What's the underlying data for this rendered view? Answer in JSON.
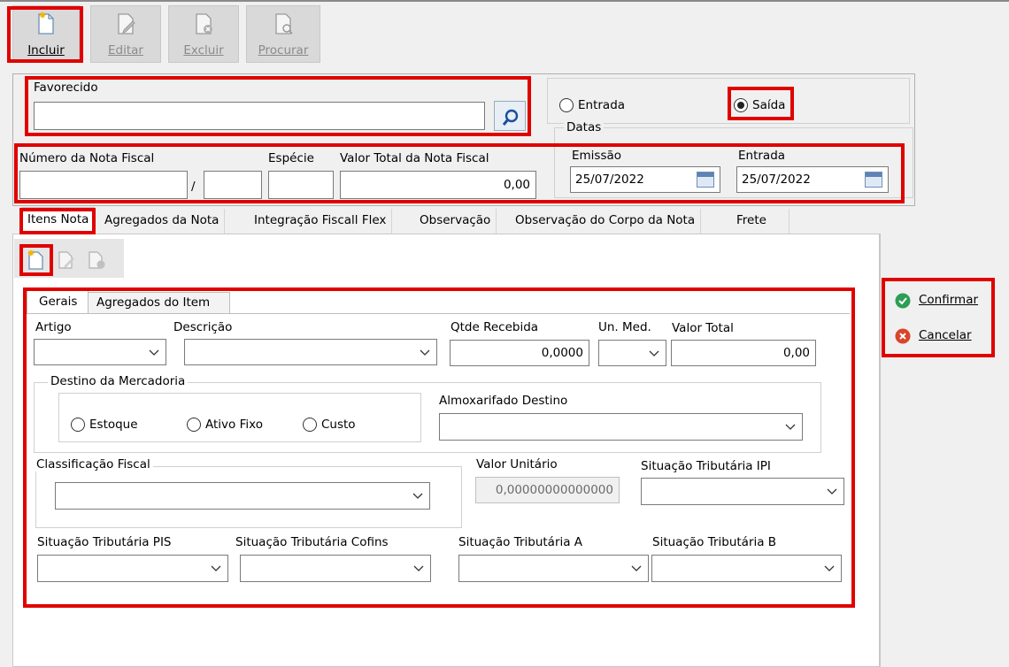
{
  "toolbar": {
    "incluir": "Incluir",
    "editar": "Editar",
    "excluir": "Excluir",
    "procurar": "Procurar"
  },
  "favorecido": {
    "label": "Favorecido",
    "value": ""
  },
  "tipo": {
    "entrada": "Entrada",
    "saida": "Saída",
    "selected": "Saída"
  },
  "datas": {
    "title": "Datas",
    "emissao_label": "Emissão",
    "emissao_value": "25/07/2022",
    "entrada_label": "Entrada",
    "entrada_value": "25/07/2022"
  },
  "nota": {
    "numero_label": "Número da Nota Fiscal",
    "separator": "/",
    "especie_label": "Espécie",
    "valor_total_label": "Valor Total da Nota Fiscal",
    "valor_total_value": "0,00"
  },
  "tabs": [
    "Itens Nota",
    "Agregados da Nota",
    "Integração Fiscall Flex",
    "Observação",
    "Observação do Corpo da Nota",
    "Frete"
  ],
  "subtabs": [
    "Gerais",
    "Agregados do Item"
  ],
  "item": {
    "artigo_label": "Artigo",
    "descricao_label": "Descrição",
    "qtde_label": "Qtde Recebida",
    "qtde_value": "0,0000",
    "unmed_label": "Un. Med.",
    "valor_total_label": "Valor Total",
    "valor_total_value": "0,00",
    "destino_title": "Destino da Mercadoria",
    "estoque": "Estoque",
    "ativo_fixo": "Ativo Fixo",
    "custo": "Custo",
    "almox_label": "Almoxarifado Destino",
    "classif_title": "Classificação Fiscal",
    "valor_unit_label": "Valor Unitário",
    "valor_unit_value": "0,00000000000000",
    "sit_ipi_label": "Situação Tributária IPI",
    "sit_pis_label": "Situação Tributária PIS",
    "sit_cofins_label": "Situação Tributária Cofins",
    "sit_a_label": "Situação Tributária A",
    "sit_b_label": "Situação Tributária B"
  },
  "actions": {
    "confirmar": "Confirmar",
    "cancelar": "Cancelar"
  },
  "colors": {
    "highlight": "#e00000",
    "confirm": "#2e9d55",
    "cancel": "#d9452b"
  }
}
